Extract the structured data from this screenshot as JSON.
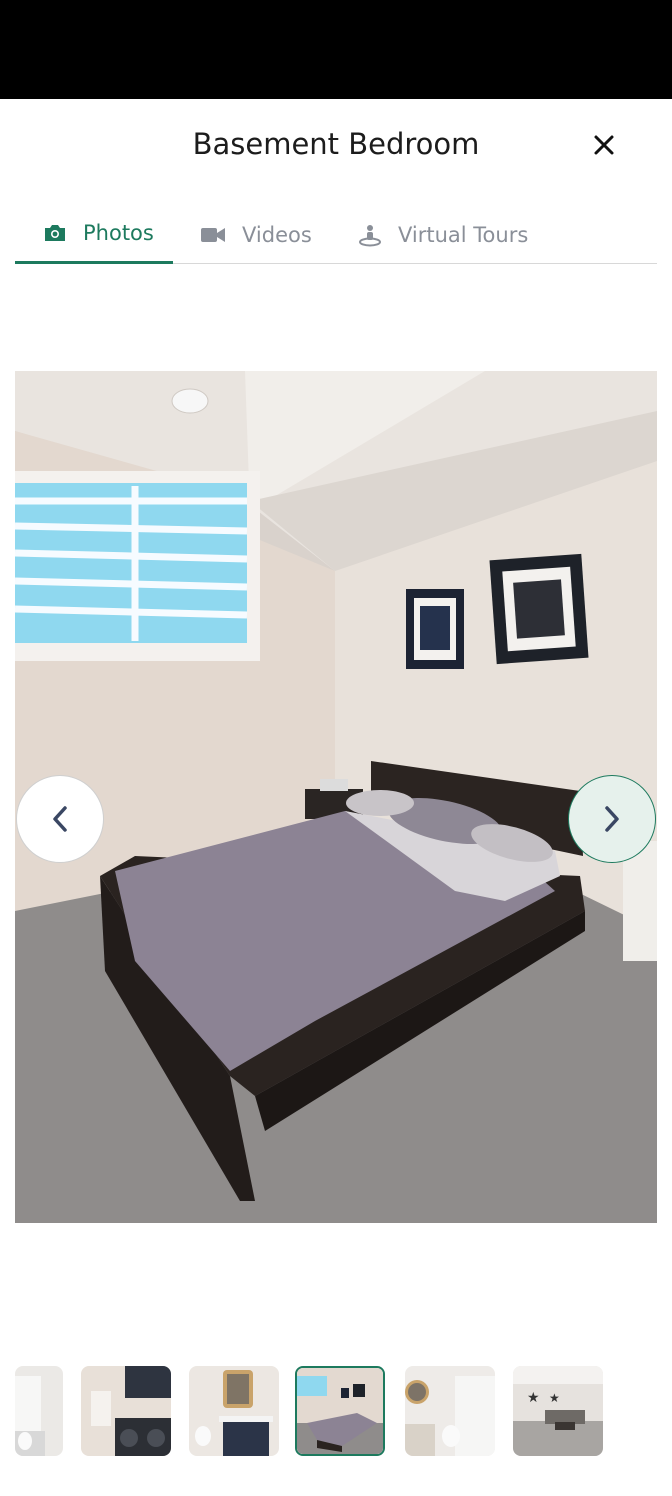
{
  "header": {
    "title": "Basement Bedroom",
    "close_icon": "close-icon"
  },
  "tabs": [
    {
      "label": "Photos",
      "icon": "camera-icon",
      "active": true
    },
    {
      "label": "Videos",
      "icon": "video-camera-icon",
      "active": false
    },
    {
      "label": "Virtual Tours",
      "icon": "person-360-icon",
      "active": false
    }
  ],
  "viewer": {
    "prev_icon": "chevron-left-icon",
    "next_icon": "chevron-right-icon"
  },
  "thumbnails": {
    "count": 6,
    "active_index": 3
  },
  "colors": {
    "accent": "#1d7a5e",
    "inactive_tab": "#8a8f98",
    "status_bar": "#000000"
  }
}
